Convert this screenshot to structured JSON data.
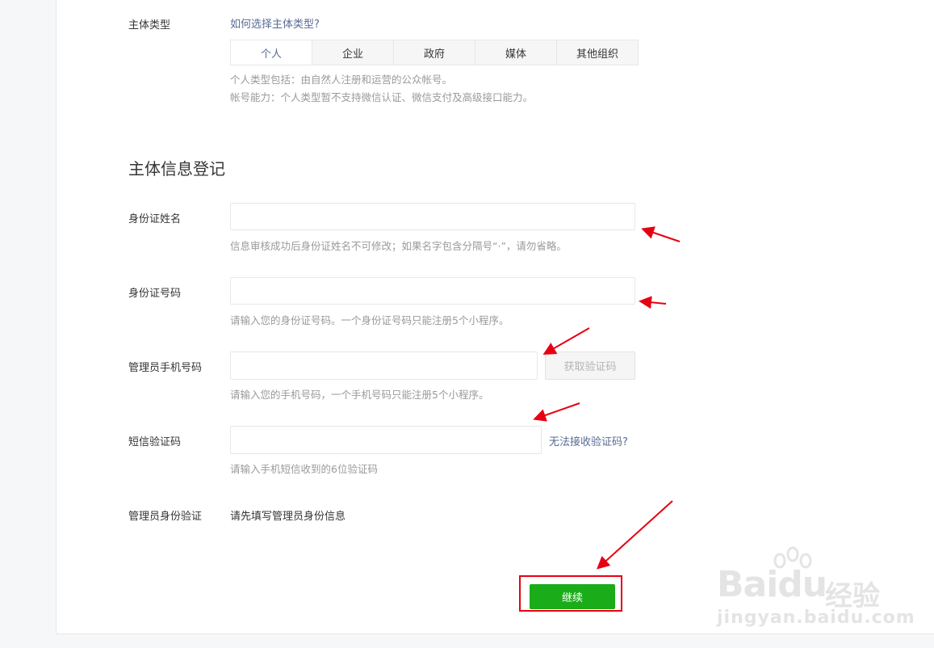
{
  "subject_type": {
    "label": "主体类型",
    "help_link": "如何选择主体类型?",
    "tabs": [
      "个人",
      "企业",
      "政府",
      "媒体",
      "其他组织"
    ],
    "active_tab": "个人",
    "desc_line1": "个人类型包括：由自然人注册和运营的公众帐号。",
    "desc_line2": "帐号能力：个人类型暂不支持微信认证、微信支付及高级接口能力。"
  },
  "section_title": "主体信息登记",
  "fields": {
    "id_name": {
      "label": "身份证姓名",
      "value": "",
      "tip": "信息审核成功后身份证姓名不可修改；如果名字包含分隔号“·”，请勿省略。"
    },
    "id_number": {
      "label": "身份证号码",
      "value": "",
      "tip": "请输入您的身份证号码。一个身份证号码只能注册5个小程序。"
    },
    "phone": {
      "label": "管理员手机号码",
      "value": "",
      "tip": "请输入您的手机号码，一个手机号码只能注册5个小程序。",
      "button": "获取验证码"
    },
    "sms_code": {
      "label": "短信验证码",
      "value": "",
      "tip": "请输入手机短信收到的6位验证码",
      "help_link": "无法接收验证码?"
    },
    "admin_verify": {
      "label": "管理员身份验证",
      "value": "请先填写管理员身份信息"
    }
  },
  "continue_button": "继续",
  "annotation_color": "#e60012",
  "watermark": {
    "logo": "Baidu",
    "brand": "经验",
    "url": "jingyan.baidu.com"
  }
}
